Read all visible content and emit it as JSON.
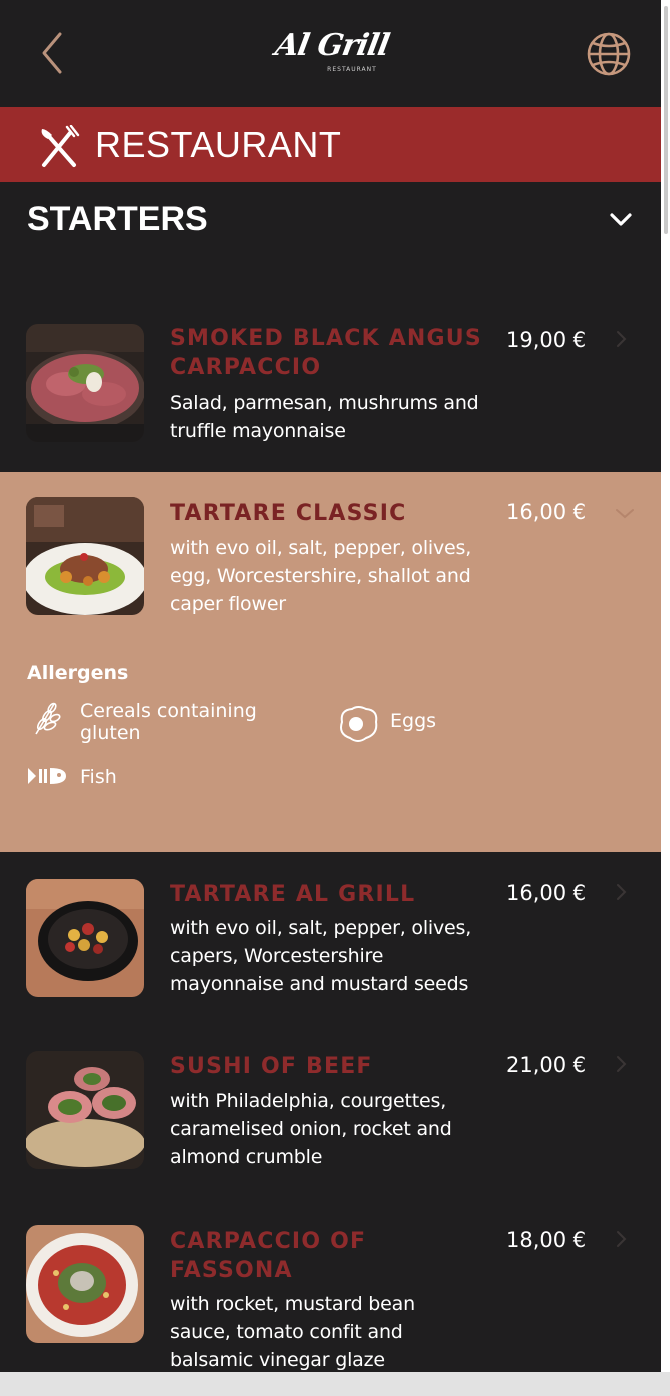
{
  "header": {
    "logo_text": "Al Grill",
    "logo_subtext": "RESTAURANT"
  },
  "banner": {
    "label": "RESTAURANT",
    "icon": "fork-knife-icon"
  },
  "section": {
    "title": "STARTERS",
    "toggle_icon": "chevron-down-icon"
  },
  "items": [
    {
      "name": "SMOKED BLACK ANGUS CARPACCIO",
      "price": "19,00 €",
      "description": "Salad, parmesan, mushrums and truffle mayonnaise",
      "expanded": false
    },
    {
      "name": "TARTARE CLASSIC",
      "price": "16,00 €",
      "description": "with evo oil, salt, pepper, olives, egg, Worcestershire, shallot and caper flower",
      "expanded": true,
      "allergens_title": "Allergens",
      "allergens": [
        {
          "label": "Cereals containing gluten",
          "icon": "wheat-icon"
        },
        {
          "label": "Eggs",
          "icon": "egg-icon"
        },
        {
          "label": "Fish",
          "icon": "fish-icon"
        }
      ]
    },
    {
      "name": "TARTARE AL GRILL",
      "price": "16,00 €",
      "description": "with evo oil, salt, pepper, olives, capers, Worcestershire mayonnaise and mustard seeds",
      "expanded": false
    },
    {
      "name": "SUSHI OF BEEF",
      "price": "21,00 €",
      "description": "with Philadelphia, courgettes, caramelised onion, rocket and almond crumble",
      "expanded": false
    },
    {
      "name": "CARPACCIO OF FASSONA",
      "price": "18,00 €",
      "description": "with rocket, mustard bean sauce, tomato confit and balsamic vinegar glaze",
      "expanded": false
    }
  ],
  "colors": {
    "background": "#1f1e1f",
    "banner": "#9b2b2b",
    "expanded_item": "#c6987d",
    "item_name": "#8e2b2c",
    "accent_icon": "#c6987d"
  }
}
